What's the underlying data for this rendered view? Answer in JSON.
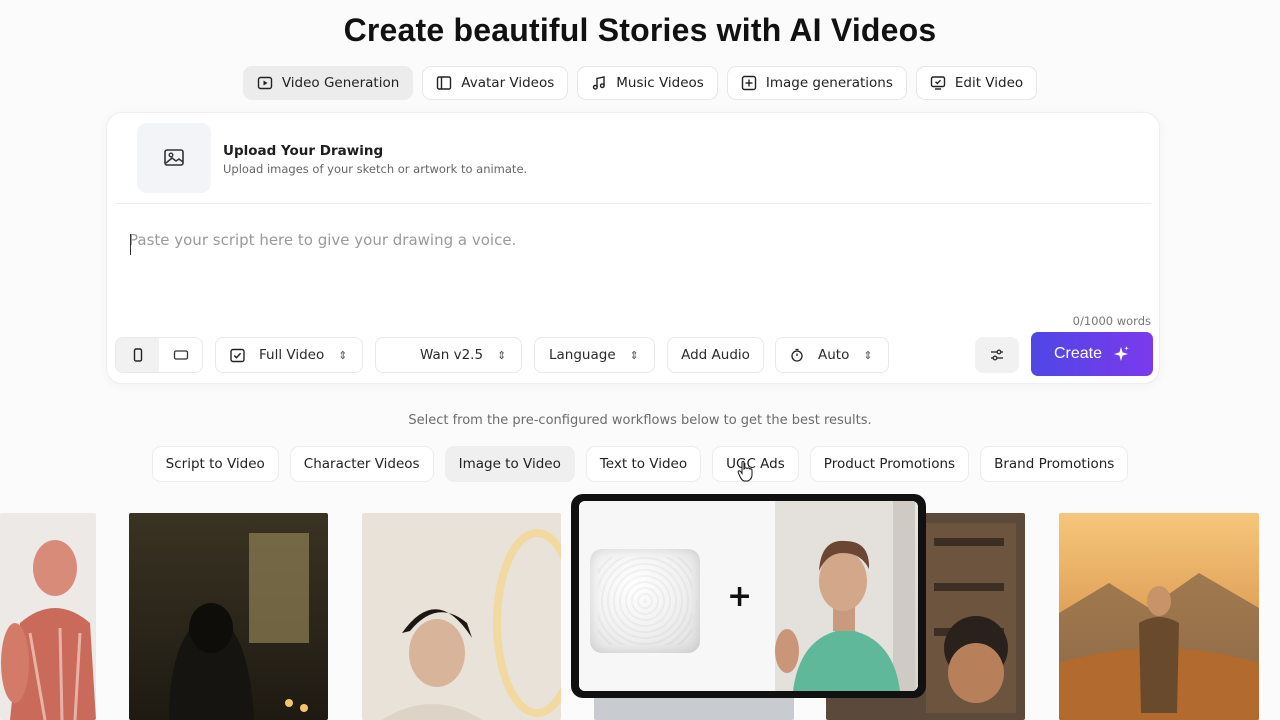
{
  "page": {
    "title": "Create beautiful Stories with AI Videos"
  },
  "tabs": [
    {
      "label": "Video Generation",
      "icon": "play-icon",
      "active": true
    },
    {
      "label": "Avatar Videos",
      "icon": "sidebar-layout-icon",
      "active": false
    },
    {
      "label": "Music Videos",
      "icon": "music-note-icon",
      "active": false
    },
    {
      "label": "Image generations",
      "icon": "image-add-icon",
      "active": false
    },
    {
      "label": "Edit Video",
      "icon": "monitor-check-icon",
      "active": false
    }
  ],
  "composer": {
    "upload_title": "Upload Your Drawing",
    "upload_subtitle": "Upload images of your sketch or artwork to animate.",
    "script_placeholder": "Paste your script here to give your drawing a voice.",
    "word_count": "0/1000 words",
    "controls": {
      "length": "Full Video",
      "model": "Wan v2.5",
      "language": "Language",
      "add_audio": "Add Audio",
      "duration": "Auto"
    },
    "create_label": "Create"
  },
  "workflows": {
    "hint": "Select from the pre-configured workflows below to get the best results.",
    "items": [
      {
        "label": "Script to Video",
        "active": false
      },
      {
        "label": "Character Videos",
        "active": false
      },
      {
        "label": "Image to Video",
        "active": true
      },
      {
        "label": "Text to Video",
        "active": false
      },
      {
        "label": "UGC Ads",
        "active": false
      },
      {
        "label": "Product Promotions",
        "active": false
      },
      {
        "label": "Brand Promotions",
        "active": false
      }
    ]
  },
  "popup": {
    "plus": "+"
  },
  "colors": {
    "accent_start": "#4f46e5",
    "accent_end": "#7c3aed"
  }
}
